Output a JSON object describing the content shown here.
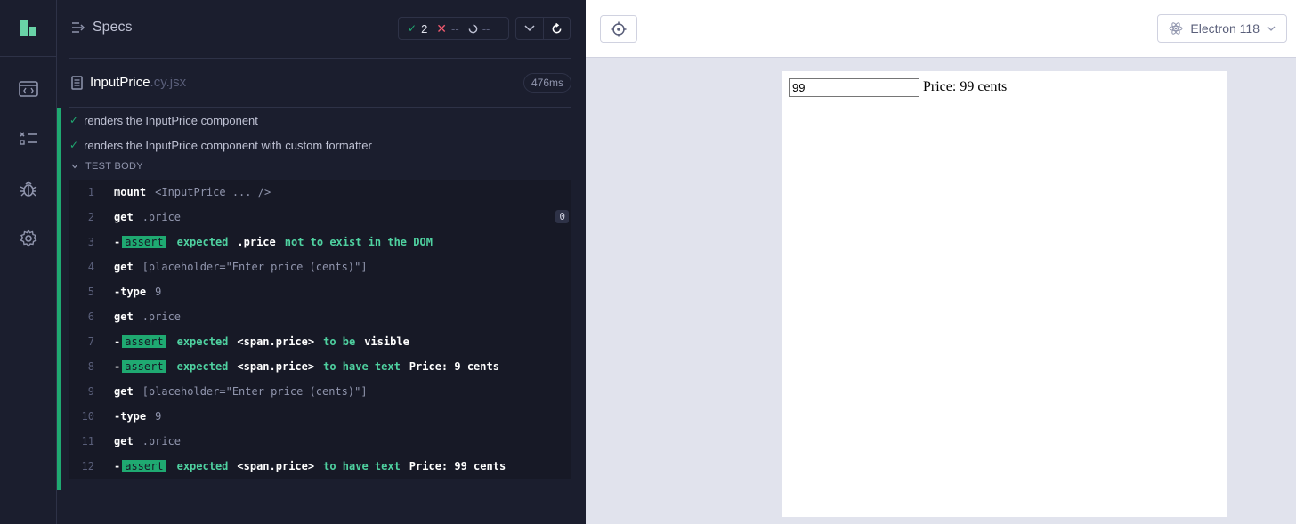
{
  "rail": {
    "nav": [
      "specs-nav",
      "runs-nav",
      "debug-nav",
      "settings-nav"
    ]
  },
  "specs": {
    "title": "Specs",
    "stats": {
      "passed": "2",
      "failed": "--",
      "pending": "--"
    }
  },
  "file": {
    "base": "InputPrice",
    "ext": ".cy.jsx",
    "duration": "476ms"
  },
  "tests": [
    "renders the InputPrice component",
    "renders the InputPrice component with custom formatter"
  ],
  "test_body_label": "TEST BODY",
  "commands": [
    {
      "num": "1",
      "name": "mount",
      "message": "<InputPrice ... />"
    },
    {
      "num": "2",
      "name": "get",
      "message": ".price",
      "count": "0"
    },
    {
      "num": "3",
      "type": "assert",
      "badge": "assert",
      "parts": [
        "expected",
        ".price",
        "not to exist in the DOM"
      ]
    },
    {
      "num": "4",
      "name": "get",
      "message": "[placeholder=\"Enter price (cents)\"]"
    },
    {
      "num": "5",
      "type": "child",
      "name": "type",
      "message": "9"
    },
    {
      "num": "6",
      "name": "get",
      "message": ".price"
    },
    {
      "num": "7",
      "type": "assert",
      "badge": "assert",
      "parts": [
        "expected",
        "<span.price>",
        "to be",
        "visible"
      ]
    },
    {
      "num": "8",
      "type": "assert",
      "badge": "assert",
      "parts": [
        "expected",
        "<span.price>",
        "to have text",
        "Price: 9 cents"
      ]
    },
    {
      "num": "9",
      "name": "get",
      "message": "[placeholder=\"Enter price (cents)\"]"
    },
    {
      "num": "10",
      "type": "child",
      "name": "type",
      "message": "9"
    },
    {
      "num": "11",
      "name": "get",
      "message": ".price"
    },
    {
      "num": "12",
      "type": "assert",
      "badge": "assert",
      "parts": [
        "expected",
        "<span.price>",
        "to have text",
        "Price: 99 cents"
      ]
    }
  ],
  "preview": {
    "browser": "Electron 118",
    "input_value": "99",
    "price_text": "Price: 99 cents"
  },
  "colors": {
    "accent": "#1fa971",
    "bg": "#1b1e2e",
    "preview_bg": "#e1e3ed"
  }
}
